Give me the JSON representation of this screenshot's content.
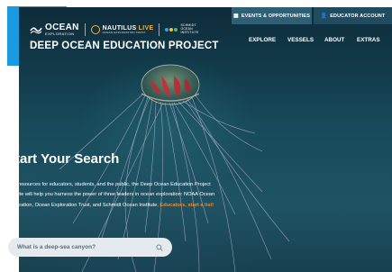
{
  "logos": {
    "ocean_exploration": {
      "title": "OCEAN",
      "subtitle": "EXPLORATION"
    },
    "nautilus_live": {
      "title_part1": "NAUTILUS",
      "title_part2": "LIVE",
      "subtitle": "OCEAN EXPLORATION TRUST"
    },
    "schmidt": {
      "line1": "SCHMIDT",
      "line2": "OCEAN",
      "line3": "INSTITUTE"
    }
  },
  "site_title": "DEEP OCEAN EDUCATION PROJECT",
  "utility": {
    "events_label": "EVENTS & OPPORTUNITIES",
    "educator_label": "EDUCATOR ACCOUNT"
  },
  "nav": {
    "explore": "EXPLORE",
    "vessels": "VESSELS",
    "about": "ABOUT",
    "extras": "EXTRAS"
  },
  "hero": {
    "headline": "Start Your Search",
    "body": "With resources for educators, students, and the public, the Deep Ocean Education Project website will help you harness the power of three leaders in ocean exploration: NOAA Ocean Exploration, Ocean Exploration Trust, and Schmidt Ocean Institute.",
    "cta": "Educators, start a list!"
  },
  "search": {
    "placeholder": "What is a deep-sea canyon?"
  },
  "colors": {
    "accent_blue": "#1a9be0",
    "events_button": "#2e5f74",
    "educator_button": "#214b5e",
    "cta_orange": "#f08a2c",
    "nautilus_gold": "#f2b43a"
  },
  "icons": {
    "events": "calendar-icon",
    "educator": "user-icon",
    "search": "search-icon"
  }
}
